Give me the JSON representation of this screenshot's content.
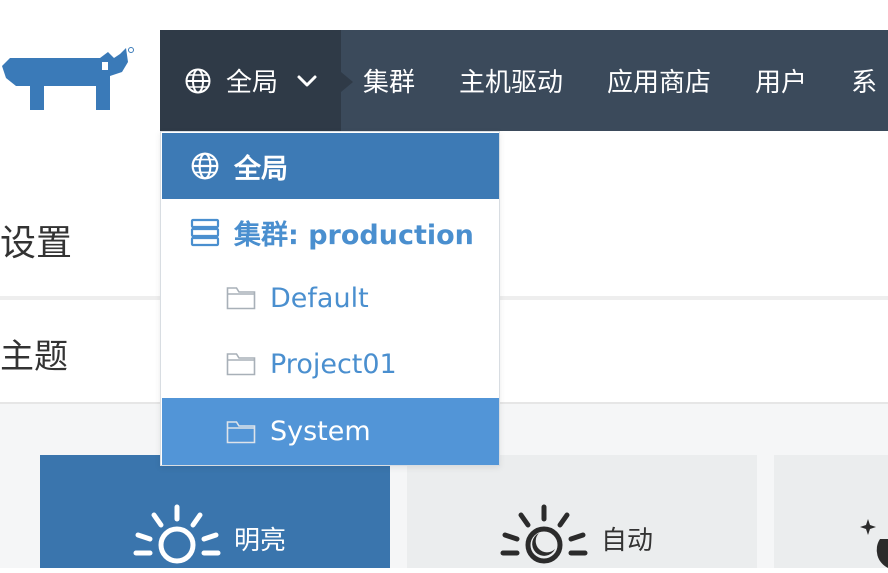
{
  "colors": {
    "nav_bg": "#3b4a5b",
    "global_bg": "#2f3a47",
    "brand_blue": "#3d7ab5",
    "link_blue": "#4a8fcf",
    "selected_blue": "#5295d7",
    "theme_active": "#3a75ad"
  },
  "header": {
    "logo_icon": "rancher-logo-icon",
    "global_switch": {
      "label": "全局",
      "icon": "globe-icon",
      "chevron": "chevron-down-icon"
    },
    "nav": [
      {
        "label": "集群"
      },
      {
        "label": "主机驱动"
      },
      {
        "label": "应用商店"
      },
      {
        "label": "用户"
      },
      {
        "label": "系"
      }
    ]
  },
  "dropdown": {
    "global": {
      "label": "全局",
      "icon": "globe-icon"
    },
    "cluster": {
      "label": "集群: production",
      "icon": "server-icon"
    },
    "projects": [
      {
        "label": "Default",
        "icon": "folder-icon"
      },
      {
        "label": "Project01",
        "icon": "folder-icon"
      },
      {
        "label": "System",
        "icon": "folder-icon",
        "selected": true
      }
    ]
  },
  "main": {
    "page_title": "设置",
    "section_title": "主题",
    "themes": [
      {
        "label": "明亮",
        "icon": "sun-icon",
        "active": true
      },
      {
        "label": "自动",
        "icon": "sun-moon-icon",
        "active": false
      },
      {
        "label": "",
        "icon": "moon-icon",
        "active": false
      }
    ]
  }
}
